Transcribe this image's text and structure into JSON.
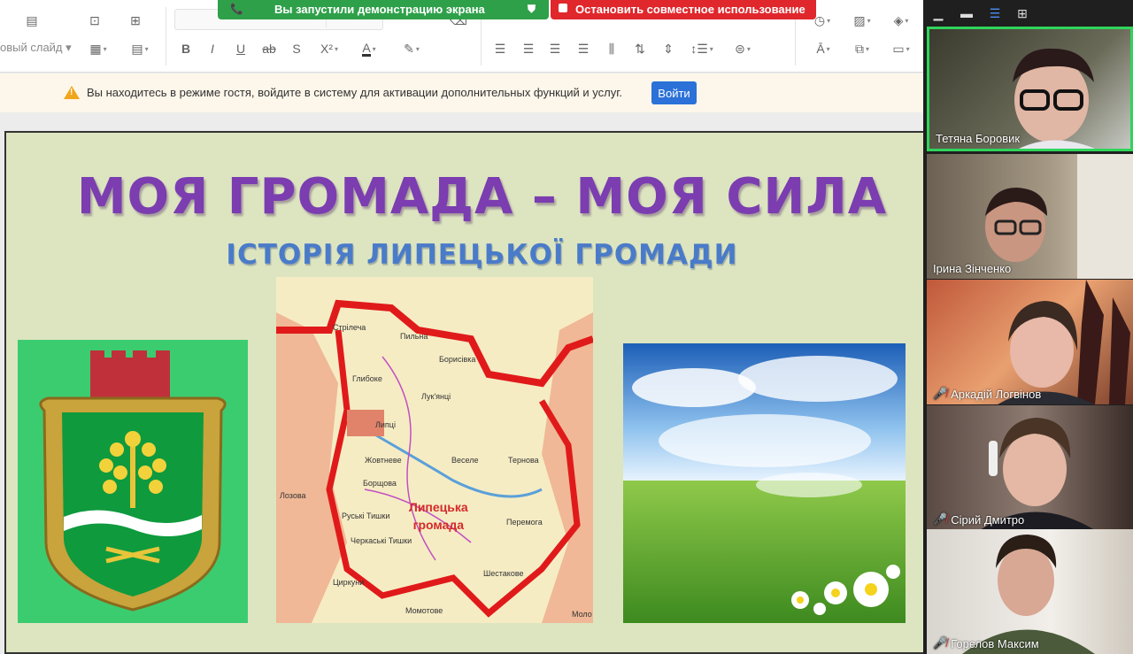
{
  "toolbar": {
    "new_slide_label": "овый слайд",
    "bold": "B",
    "italic": "I",
    "underline": "U",
    "strike": "ab",
    "shadow": "S",
    "superscript": "X²"
  },
  "share_banner": {
    "label": "Вы запустили демонстрацию экрана",
    "stop_label": "Остановить совместное использование"
  },
  "guest_notice": {
    "message": "Вы находитесь в режиме гостя, войдите в систему для активации дополнительных функций и услуг.",
    "login_label": "Войти"
  },
  "slide": {
    "title": "МОЯ ГРОМАДА – МОЯ СИЛА",
    "subtitle": "ІСТОРІЯ ЛИПЕЦЬКОЇ ГРОМАДИ",
    "map": {
      "region_line1": "Липецька",
      "region_line2": "громада",
      "towns": [
        "Стрілеча",
        "Пильна",
        "Борисівка",
        "Глибоке",
        "Лук'янці",
        "Липці",
        "Жовтневе",
        "Веселе",
        "Тернова",
        "Борщова",
        "Руські Тишки",
        "Черкаські Тишки",
        "Перемога",
        "Циркуни",
        "Шестакове",
        "Момотове",
        "Лозова",
        "Моло"
      ]
    }
  },
  "participants": [
    {
      "name": "Тетяна Боровик",
      "muted": false
    },
    {
      "name": "Ірина Зінченко",
      "muted": false
    },
    {
      "name": "Аркадій Логвінов",
      "muted": true
    },
    {
      "name": "Сірий Дмитро",
      "muted": true
    },
    {
      "name": "Горєлов Максим",
      "muted": true
    }
  ],
  "colors": {
    "share_green": "#2fa04a",
    "stop_red": "#e0272c",
    "login_blue": "#2b71d8",
    "title_purple": "#7b3db0",
    "subtitle_blue": "#4a7bc9",
    "active_speaker": "#2fd45a"
  }
}
